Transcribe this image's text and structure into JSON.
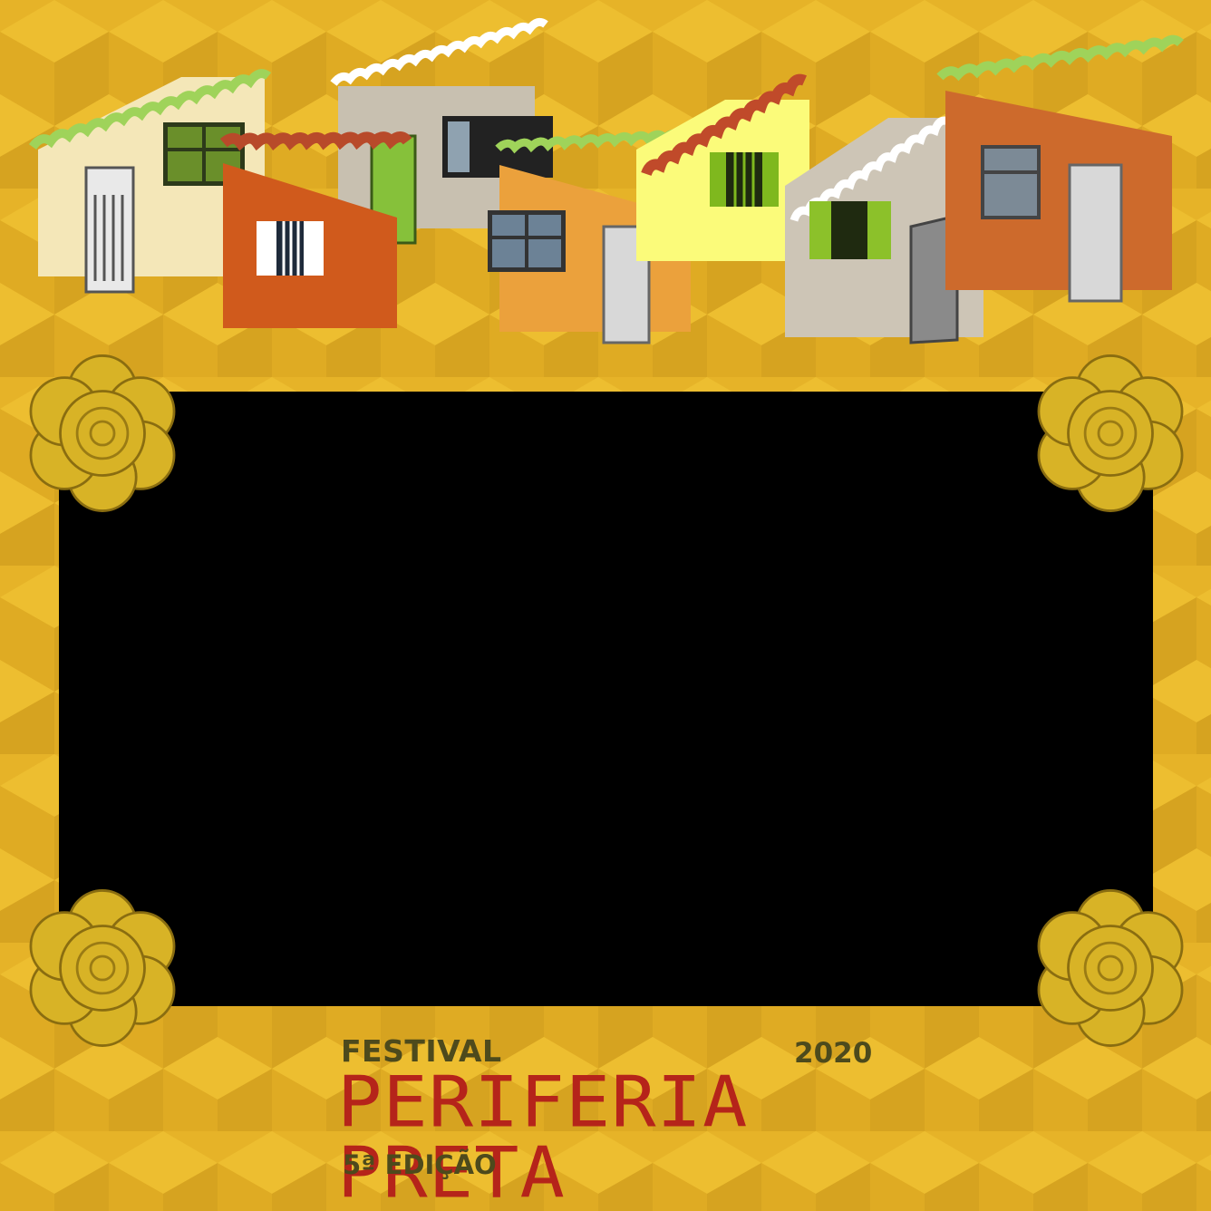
{
  "logo": {
    "festival": "FESTIVAL",
    "year": "2020",
    "title": "PERIFERIA PRETA",
    "edition": "5ª EDIÇÃO"
  },
  "colors": {
    "background_gold": "#e6b328",
    "photo_area": "#000000",
    "title_red": "#b5241a",
    "label_olive": "#4d4a1c"
  },
  "decorations": {
    "corner_ornament": "flower-rosette-icon",
    "header": "houses-illustration"
  }
}
